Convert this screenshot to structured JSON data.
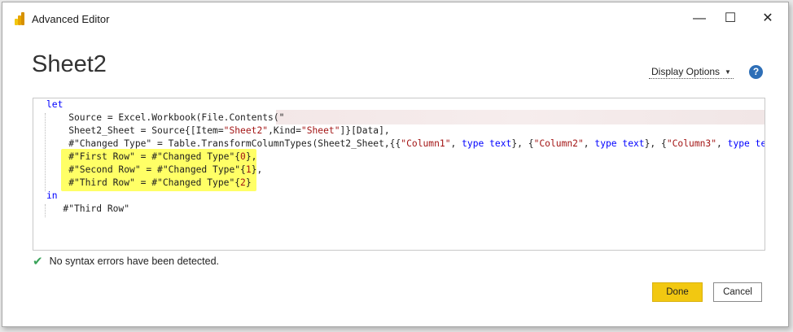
{
  "window": {
    "title": "Advanced Editor",
    "minimize_glyph": "—",
    "maximize_glyph": "☐",
    "close_glyph": "✕"
  },
  "query": {
    "name": "Sheet2"
  },
  "toolbar": {
    "display_options_label": "Display Options",
    "help_glyph": "?"
  },
  "code": {
    "lines": [
      [
        {
          "t": "let",
          "c": "kw"
        }
      ],
      [
        {
          "t": "    Source = Excel.Workbook(File.Contents(\""
        }
      ],
      [
        {
          "t": "    Sheet2_Sheet = Source{[Item="
        },
        {
          "t": "\"Sheet2\"",
          "c": "str"
        },
        {
          "t": ",Kind="
        },
        {
          "t": "\"Sheet\"",
          "c": "str"
        },
        {
          "t": "]}[Data],"
        }
      ],
      [
        {
          "t": "    #\"Changed Type\" = Table.TransformColumnTypes(Sheet2_Sheet,{{"
        },
        {
          "t": "\"Column1\"",
          "c": "str"
        },
        {
          "t": ", "
        },
        {
          "t": "type text",
          "c": "kw"
        },
        {
          "t": "}, {"
        },
        {
          "t": "\"Column2\"",
          "c": "str"
        },
        {
          "t": ", "
        },
        {
          "t": "type text",
          "c": "kw"
        },
        {
          "t": "}, {"
        },
        {
          "t": "\"Column3\"",
          "c": "str"
        },
        {
          "t": ", "
        },
        {
          "t": "type text",
          "c": "kw"
        },
        {
          "t": "},"
        }
      ],
      [
        {
          "t": "    #\"First Row\" = #\"Changed Type\"{"
        },
        {
          "t": "0",
          "c": "str"
        },
        {
          "t": "},"
        }
      ],
      [
        {
          "t": "    #\"Second Row\" = #\"Changed Type\"{"
        },
        {
          "t": "1",
          "c": "str"
        },
        {
          "t": "},"
        }
      ],
      [
        {
          "t": "    #\"Third Row\" = #\"Changed Type\"{"
        },
        {
          "t": "2",
          "c": "str"
        },
        {
          "t": "}"
        }
      ],
      [
        {
          "t": "in",
          "c": "kw"
        }
      ],
      [
        {
          "t": "   #\"Third Row\""
        }
      ]
    ]
  },
  "status": {
    "message": "No syntax errors have been detected."
  },
  "buttons": {
    "done_label": "Done",
    "cancel_label": "Cancel"
  },
  "colors": {
    "highlight": "#ffff66",
    "keyword": "#0000ff",
    "string": "#a31515",
    "done_button": "#f2c811",
    "success_check": "#3aa35a",
    "help_icon": "#2e6fb7"
  },
  "icons": {
    "app": "power-bi-icon",
    "status": "checkmark-icon",
    "help": "help-icon"
  }
}
